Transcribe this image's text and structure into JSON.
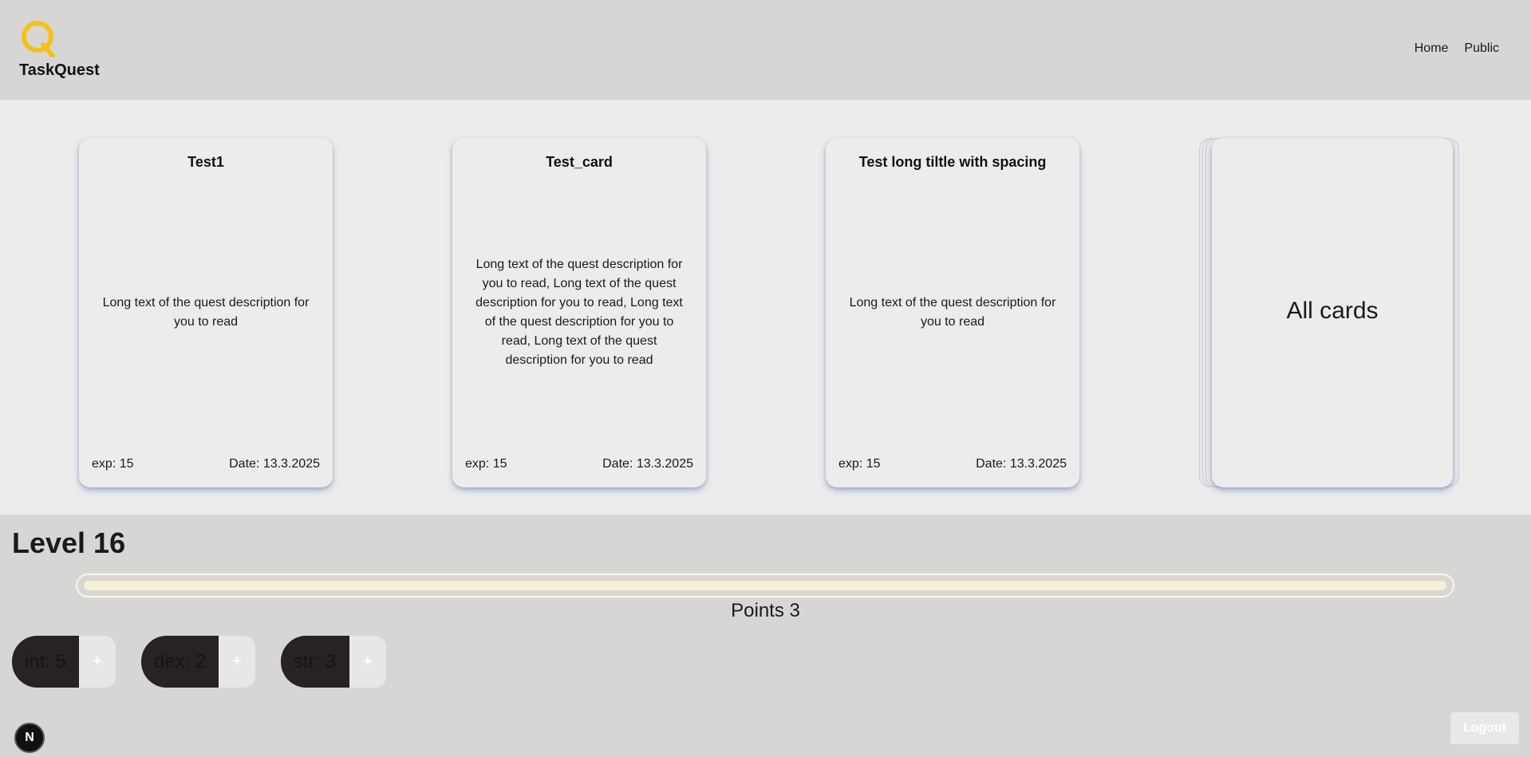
{
  "header": {
    "brand": "TaskQuest",
    "nav": [
      {
        "label": "Home"
      },
      {
        "label": "Public"
      }
    ],
    "accent_color": "#f2c21b"
  },
  "cards": [
    {
      "title": "Test1",
      "description": "Long text of the quest description for you to read",
      "exp": "exp: 15",
      "date": "Date: 13.3.2025"
    },
    {
      "title": "Test_card",
      "description": "Long text of the quest description for you to read, Long text of the quest description for you to read, Long text of the quest description for you to read, Long text of the quest description for you to read",
      "exp": "exp: 15",
      "date": "Date: 13.3.2025"
    },
    {
      "title": "Test long tiltle with spacing",
      "description": "Long text of the quest description for you to read",
      "exp": "exp: 15",
      "date": "Date: 13.3.2025"
    }
  ],
  "all_cards": {
    "label": "All cards"
  },
  "level": {
    "title": "Level 16",
    "progress_percent": 100,
    "points": "Points 3"
  },
  "stats": [
    {
      "label": "int: 5",
      "plus": "+"
    },
    {
      "label": "dex: 2",
      "plus": "+"
    },
    {
      "label": "str: 3",
      "plus": "+"
    }
  ],
  "footer": {
    "badge": "N",
    "logout": "Logout"
  }
}
